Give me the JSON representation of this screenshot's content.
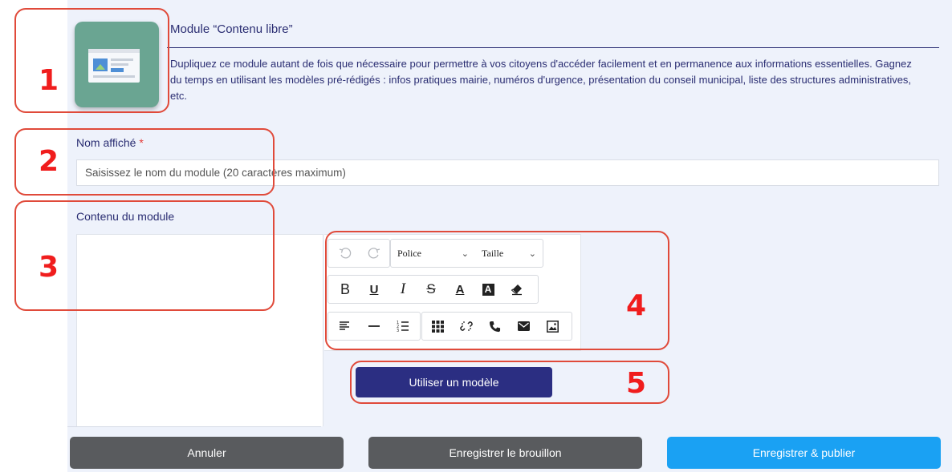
{
  "header": {
    "title": "Module “Contenu libre”",
    "description": "Dupliquez ce module autant de fois que nécessaire pour permettre à vos citoyens d'accéder facilement et en permanence aux informations essentielles. Gagnez du temps en utilisant les modèles pré-rédigés : infos pratiques mairie, numéros d'urgence, présentation du conseil municipal, liste des structures administratives, etc.",
    "thumbnail_icon": "content-window-image-icon"
  },
  "name_field": {
    "label": "Nom affiché",
    "required_mark": "*",
    "value": "",
    "placeholder": "Saisissez le nom du module (20 caractères maximum)"
  },
  "content_field": {
    "label": "Contenu du module"
  },
  "toolbar": {
    "row1": {
      "undo_icon": "undo-icon",
      "redo_icon": "redo-icon",
      "font_select": "Police",
      "size_select": "Taille"
    },
    "row2": [
      "bold-icon",
      "underline-icon",
      "italic-icon",
      "strikethrough-icon",
      "text-color-icon",
      "highlight-icon",
      "eraser-icon"
    ],
    "row3": [
      "align-left-icon",
      "horizontal-rule-icon",
      "ordered-list-icon",
      "table-icon",
      "unlink-icon",
      "phone-icon",
      "mail-icon",
      "image-icon"
    ]
  },
  "template_button": "Utiliser un modèle",
  "footer": {
    "cancel": "Annuler",
    "save_draft": "Enregistrer le brouillon",
    "save_publish": "Enregistrer & publier"
  },
  "annotations": [
    "1",
    "2",
    "3",
    "4",
    "5"
  ],
  "colors": {
    "annotation": "#e04a3a",
    "annotation_number": "#f01d1d",
    "title_text": "#2a2d72",
    "primary_button": "#2b2e82",
    "publish_button": "#1aa1f3",
    "grey_button": "#595b5e",
    "panel_background": "#eef2fb",
    "thumbnail": "#6aa592"
  }
}
